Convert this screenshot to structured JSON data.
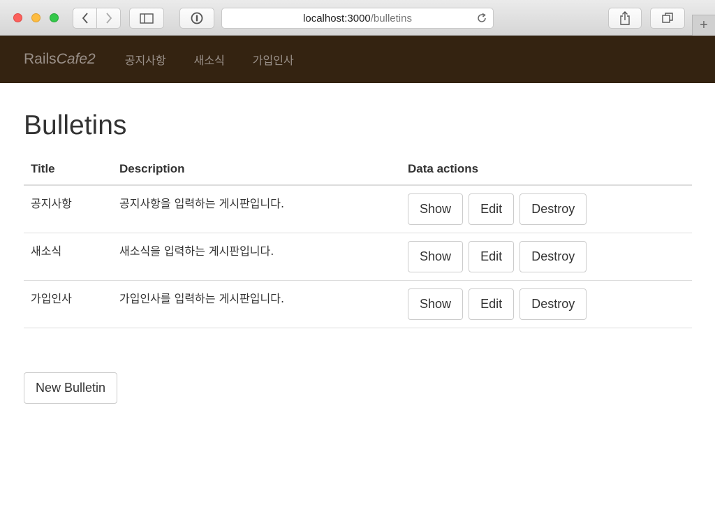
{
  "browser": {
    "url_host": "localhost:3000",
    "url_path": "/bulletins",
    "new_tab_label": "+"
  },
  "navbar": {
    "brand_plain": "Rails",
    "brand_italic": "Cafe2",
    "links": [
      "공지사항",
      "새소식",
      "가입인사"
    ]
  },
  "page": {
    "title": "Bulletins",
    "columns": [
      "Title",
      "Description",
      "Data actions"
    ],
    "rows": [
      {
        "title": "공지사항",
        "description": "공지사항을 입력하는 게시판입니다."
      },
      {
        "title": "새소식",
        "description": "새소식을 입력하는 게시판입니다."
      },
      {
        "title": "가입인사",
        "description": "가입인사를 입력하는 게시판입니다."
      }
    ],
    "actions": {
      "show": "Show",
      "edit": "Edit",
      "destroy": "Destroy"
    },
    "new_button": "New Bulletin"
  },
  "colors": {
    "navbar_bg": "#342311",
    "navbar_text": "#9a9089"
  }
}
